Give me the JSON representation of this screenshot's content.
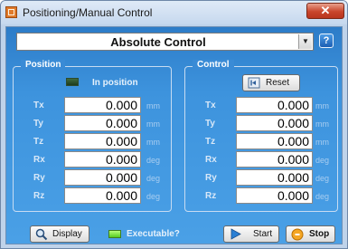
{
  "window": {
    "title": "Positioning/Manual Control",
    "close_glyph": "✕"
  },
  "mode_select": {
    "selected": "Absolute Control",
    "arrow": "▼"
  },
  "help": {
    "glyph": "?"
  },
  "position": {
    "title": "Position",
    "status_label": "In position",
    "rows": [
      {
        "label": "Tx",
        "value": "0.000",
        "unit": "mm"
      },
      {
        "label": "Ty",
        "value": "0.000",
        "unit": "mm"
      },
      {
        "label": "Tz",
        "value": "0.000",
        "unit": "mm"
      },
      {
        "label": "Rx",
        "value": "0.000",
        "unit": "deg"
      },
      {
        "label": "Ry",
        "value": "0.000",
        "unit": "deg"
      },
      {
        "label": "Rz",
        "value": "0.000",
        "unit": "deg"
      }
    ]
  },
  "control": {
    "title": "Control",
    "reset_label": "Reset",
    "rows": [
      {
        "label": "Tx",
        "value": "0.000",
        "unit": "mm"
      },
      {
        "label": "Ty",
        "value": "0.000",
        "unit": "mm"
      },
      {
        "label": "Tz",
        "value": "0.000",
        "unit": "mm"
      },
      {
        "label": "Rx",
        "value": "0.000",
        "unit": "deg"
      },
      {
        "label": "Ry",
        "value": "0.000",
        "unit": "deg"
      },
      {
        "label": "Rz",
        "value": "0.000",
        "unit": "deg"
      }
    ]
  },
  "footer": {
    "display_label": "Display",
    "executable_label": "Executable?",
    "start_label": "Start",
    "stop_label": "Stop"
  },
  "colors": {
    "panel": "#3d93dd",
    "led_on": "#7ee83a",
    "led_dark": "#2d552d",
    "close": "#c9452b"
  }
}
